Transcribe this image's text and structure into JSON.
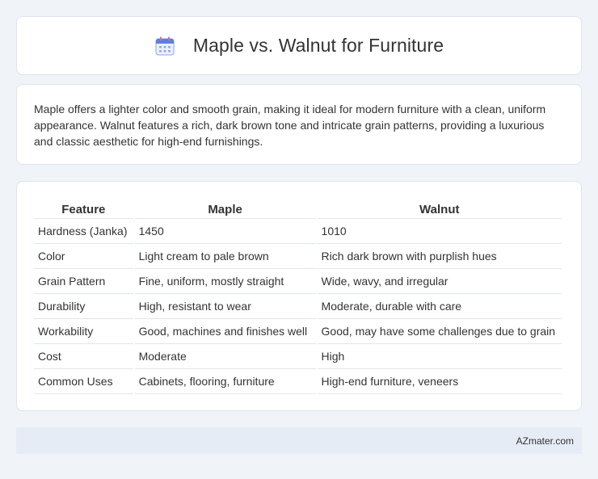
{
  "header": {
    "title": "Maple vs. Walnut for Furniture",
    "icon": "calendar-icon"
  },
  "description": {
    "text": "Maple offers a lighter color and smooth grain, making it ideal for modern furniture with a clean, uniform appearance. Walnut features a rich, dark brown tone and intricate grain patterns, providing a luxurious and classic aesthetic for high-end furnishings."
  },
  "table": {
    "headers": [
      "Feature",
      "Maple",
      "Walnut"
    ],
    "rows": [
      [
        "Hardness (Janka)",
        "1450",
        "1010"
      ],
      [
        "Color",
        "Light cream to pale brown",
        "Rich dark brown with purplish hues"
      ],
      [
        "Grain Pattern",
        "Fine, uniform, mostly straight",
        "Wide, wavy, and irregular"
      ],
      [
        "Durability",
        "High, resistant to wear",
        "Moderate, durable with care"
      ],
      [
        "Workability",
        "Good, machines and finishes well",
        "Good, may have some challenges due to grain"
      ],
      [
        "Cost",
        "Moderate",
        "High"
      ],
      [
        "Common Uses",
        "Cabinets, flooring, furniture",
        "High-end furniture, veneers"
      ]
    ]
  },
  "footer": {
    "site": "AZmater.com"
  },
  "colors": {
    "background": "#f0f3f8",
    "card": "#ffffff",
    "footer": "#e6ecf6",
    "icon_accent": "#5b7fe0"
  }
}
